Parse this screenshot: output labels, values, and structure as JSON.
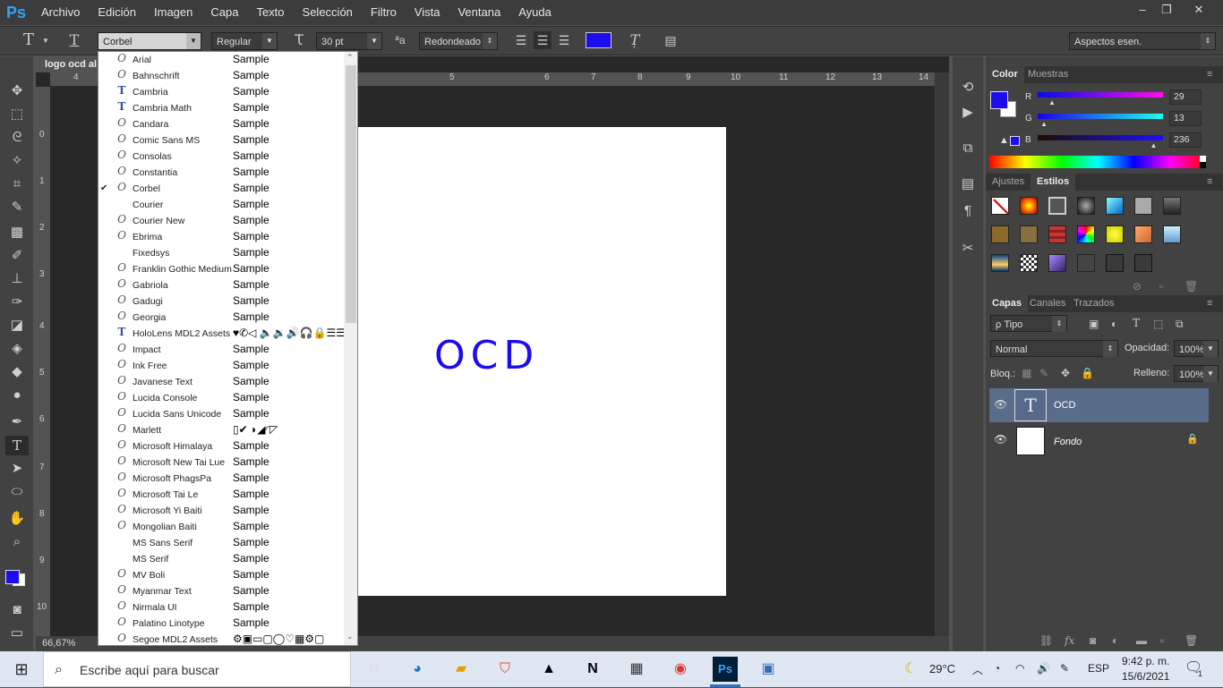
{
  "app": {
    "logo": "Ps"
  },
  "menu": [
    "Archivo",
    "Edición",
    "Imagen",
    "Capa",
    "Texto",
    "Selección",
    "Filtro",
    "Vista",
    "Ventana",
    "Ayuda"
  ],
  "window_controls": {
    "minimize": "‒",
    "restore": "❐",
    "close": "✕"
  },
  "options": {
    "font_family": "Corbel",
    "font_style": "Regular",
    "font_size": "30 pt",
    "aa_label": "ªa",
    "antialias": "Redondeado",
    "text_color": "#1d0dec",
    "workspace": "Aspectos esen."
  },
  "document": {
    "tab_title": "logo ocd al",
    "zoom": "66,67%",
    "text": "OCD",
    "text_color": "#1d0dec"
  },
  "ruler_h": [
    "4",
    "5",
    "6",
    "7",
    "8",
    "9",
    "10",
    "11",
    "12",
    "13",
    "14"
  ],
  "ruler_v": [
    "0",
    "1",
    "2",
    "3",
    "4",
    "5",
    "6",
    "7",
    "8",
    "9",
    "10"
  ],
  "font_list": [
    {
      "name": "Arial",
      "sample": "Sample",
      "icon": "O"
    },
    {
      "name": "Bahnschrift",
      "sample": "Sample",
      "icon": "O"
    },
    {
      "name": "Cambria",
      "sample": "Sample",
      "icon": "T"
    },
    {
      "name": "Cambria Math",
      "sample": "Sample",
      "icon": "T"
    },
    {
      "name": "Candara",
      "sample": "Sample",
      "icon": "O"
    },
    {
      "name": "Comic Sans MS",
      "sample": "Sample",
      "icon": "O"
    },
    {
      "name": "Consolas",
      "sample": "Sample",
      "icon": "O"
    },
    {
      "name": "Constantia",
      "sample": "Sample",
      "icon": "O"
    },
    {
      "name": "Corbel",
      "sample": "Sample",
      "icon": "O",
      "checked": "✔"
    },
    {
      "name": "Courier",
      "sample": "Sample",
      "icon": ""
    },
    {
      "name": "Courier New",
      "sample": "Sample",
      "icon": "O"
    },
    {
      "name": "Ebrima",
      "sample": "Sample",
      "icon": "O"
    },
    {
      "name": "Fixedsys",
      "sample": "Sample",
      "icon": ""
    },
    {
      "name": "Franklin Gothic Medium",
      "sample": "Sample",
      "icon": "O"
    },
    {
      "name": "Gabriola",
      "sample": "Sample",
      "icon": "O"
    },
    {
      "name": "Gadugi",
      "sample": "Sample",
      "icon": "O"
    },
    {
      "name": "Georgia",
      "sample": "Sample",
      "icon": "O"
    },
    {
      "name": "HoloLens MDL2 Assets",
      "sample": "♥✆◁ 🔈🔉🔊🎧🔒☰☰",
      "icon": "T"
    },
    {
      "name": "Impact",
      "sample": "Sample",
      "icon": "O"
    },
    {
      "name": "Ink Free",
      "sample": "Sample",
      "icon": "O"
    },
    {
      "name": "Javanese Text",
      "sample": "Sample",
      "icon": "O"
    },
    {
      "name": "Lucida Console",
      "sample": "Sample",
      "icon": "O"
    },
    {
      "name": "Lucida Sans Unicode",
      "sample": "Sample",
      "icon": "O"
    },
    {
      "name": "Marlett",
      "sample": "▯✔ ◗◢◜◸",
      "icon": "O"
    },
    {
      "name": "Microsoft Himalaya",
      "sample": "Sample",
      "icon": "O"
    },
    {
      "name": "Microsoft New Tai Lue",
      "sample": "Sample",
      "icon": "O"
    },
    {
      "name": "Microsoft PhagsPa",
      "sample": "Sample",
      "icon": "O"
    },
    {
      "name": "Microsoft Tai Le",
      "sample": "Sample",
      "icon": "O"
    },
    {
      "name": "Microsoft Yi Baiti",
      "sample": "Sample",
      "icon": "O"
    },
    {
      "name": "Mongolian Baiti",
      "sample": "Sample",
      "icon": "O"
    },
    {
      "name": "MS Sans Serif",
      "sample": "Sample",
      "icon": ""
    },
    {
      "name": "MS Serif",
      "sample": "Sample",
      "icon": ""
    },
    {
      "name": "MV Boli",
      "sample": "Sample",
      "icon": "O"
    },
    {
      "name": "Myanmar Text",
      "sample": "Sample",
      "icon": "O"
    },
    {
      "name": "Nirmala UI",
      "sample": "Sample",
      "icon": "O"
    },
    {
      "name": "Palatino Linotype",
      "sample": "Sample",
      "icon": "O"
    },
    {
      "name": "Segoe MDL2 Assets",
      "sample": "⚙▣▭▢◯♡▦⚙▢",
      "icon": "O"
    }
  ],
  "color_panel": {
    "tabs": [
      "Color",
      "Muestras"
    ],
    "r_label": "R",
    "g_label": "G",
    "b_label": "B",
    "r": "29",
    "g": "13",
    "b": "236",
    "r_frac": 0.114,
    "g_frac": 0.051,
    "b_frac": 0.925,
    "foreground": "#1d0dec",
    "background": "#ffffff"
  },
  "styles_panel": {
    "tabs": [
      "Ajustes",
      "Estilos"
    ]
  },
  "layers_panel": {
    "tabs": [
      "Capas",
      "Canales",
      "Trazados"
    ],
    "filter": "ρ Tipo",
    "blend": "Normal",
    "opacity_label": "Opacidad:",
    "opacity": "100%",
    "lock_label": "Bloq.:",
    "fill_label": "Relleno:",
    "fill": "100%",
    "layers": [
      {
        "name": "OCD",
        "thumb": "T",
        "selected": true
      },
      {
        "name": "Fondo",
        "thumb": "",
        "selected": false
      }
    ]
  },
  "taskbar": {
    "search_placeholder": "Escribe aquí para buscar",
    "weather": "29°C",
    "lang": "ESP",
    "time": "9:42 p. m.",
    "date": "15/6/2021",
    "notifications": "1"
  }
}
